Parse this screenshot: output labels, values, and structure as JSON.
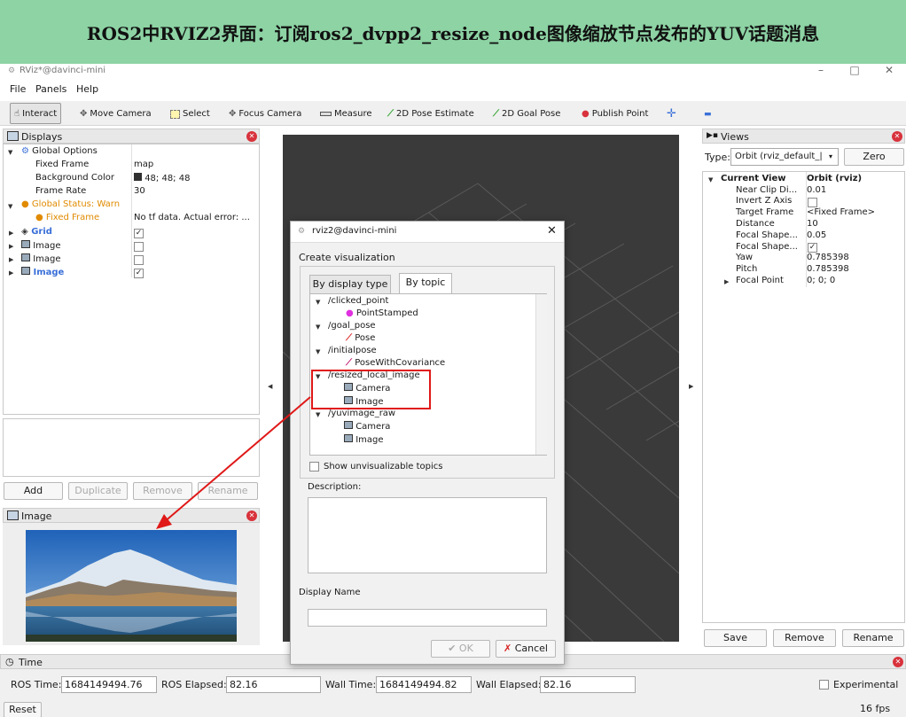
{
  "banner": {
    "title": "ROS2中RVIZ2界面：订阅ros2_dvpp2_resize_node图像缩放节点发布的YUV话题消息"
  },
  "window": {
    "title": "RViz*@davinci-mini",
    "minimize": "–",
    "maximize": "□",
    "close": "✕"
  },
  "menu": {
    "file": "File",
    "panels": "Panels",
    "help": "Help"
  },
  "toolbar": {
    "interact": "Interact",
    "move_camera": "Move Camera",
    "select": "Select",
    "focus_camera": "Focus Camera",
    "measure": "Measure",
    "pose_estimate": "2D Pose Estimate",
    "goal_pose": "2D Goal Pose",
    "publish_point": "Publish Point",
    "add": "✛",
    "remove": "▬"
  },
  "displays": {
    "title": "Displays",
    "rows": {
      "global_options": "Global Options",
      "fixed_frame": "Fixed Frame",
      "fixed_frame_val": "map",
      "bg_color": "Background Color",
      "bg_color_val": "48; 48; 48",
      "frame_rate": "Frame Rate",
      "frame_rate_val": "30",
      "global_status": "Global Status: Warn",
      "status_fixed_frame": "Fixed Frame",
      "status_fixed_frame_val": "No tf data.  Actual error: ...",
      "grid": "Grid",
      "image1": "Image",
      "image2": "Image",
      "image3": "Image"
    },
    "buttons": {
      "add": "Add",
      "duplicate": "Duplicate",
      "remove": "Remove",
      "rename": "Rename"
    }
  },
  "image_panel": {
    "title": "Image"
  },
  "dialog": {
    "title": "rviz2@davinci-mini",
    "subtitle": "Create visualization",
    "tab_display_type": "By display type",
    "tab_by_topic": "By topic",
    "topics": [
      {
        "name": "/clicked_point",
        "children": [
          "PointStamped"
        ]
      },
      {
        "name": "/goal_pose",
        "children": [
          "Pose"
        ]
      },
      {
        "name": "/initialpose",
        "children": [
          "PoseWithCovariance"
        ]
      },
      {
        "name": "/resized_local_image",
        "children": [
          "Camera",
          "Image"
        ]
      },
      {
        "name": "/yuvimage_raw",
        "children": [
          "Camera",
          "Image"
        ]
      }
    ],
    "show_unvisualizable": "Show unvisualizable topics",
    "description_label": "Description:",
    "display_name_label": "Display Name",
    "ok": "OK",
    "cancel": "Cancel"
  },
  "views": {
    "title": "Views",
    "type_label": "Type:",
    "type_value": "Orbit (rviz_default_|",
    "zero": "Zero",
    "current_view": "Current View",
    "current_view_val": "Orbit (rviz)",
    "props": [
      {
        "k": "Near Clip Di...",
        "v": "0.01"
      },
      {
        "k": "Invert Z Axis",
        "v": ""
      },
      {
        "k": "Target Frame",
        "v": "<Fixed Frame>"
      },
      {
        "k": "Distance",
        "v": "10"
      },
      {
        "k": "Focal Shape...",
        "v": "0.05"
      },
      {
        "k": "Focal Shape...",
        "v": "✓"
      },
      {
        "k": "Yaw",
        "v": "0.785398"
      },
      {
        "k": "Pitch",
        "v": "0.785398"
      },
      {
        "k": "Focal Point",
        "v": "0; 0; 0"
      }
    ],
    "save": "Save",
    "remove": "Remove",
    "rename": "Rename"
  },
  "time": {
    "title": "Time",
    "ros_time_label": "ROS Time:",
    "ros_time": "1684149494.76",
    "ros_elapsed_label": "ROS Elapsed:",
    "ros_elapsed": "82.16",
    "wall_time_label": "Wall Time:",
    "wall_time": "1684149494.82",
    "wall_elapsed_label": "Wall Elapsed:",
    "wall_elapsed": "82.16",
    "experimental": "Experimental",
    "reset": "Reset",
    "fps": "16 fps"
  },
  "colors": {
    "warn": "#e08a00",
    "highlight": "#e01818",
    "grid": "#5a5a5a",
    "viewport_bg": "#303030"
  }
}
